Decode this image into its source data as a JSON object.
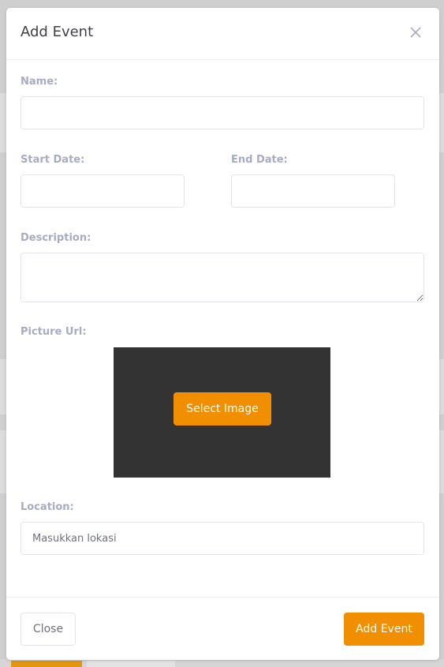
{
  "modal": {
    "title": "Add Event",
    "close_icon": "close-x-icon"
  },
  "form": {
    "name_label": "Name:",
    "name_value": "",
    "start_date_label": "Start Date:",
    "start_date_value": "",
    "end_date_label": "End Date:",
    "end_date_value": "",
    "description_label": "Description:",
    "description_value": "",
    "picture_url_label": "Picture Url:",
    "select_image_label": "Select Image",
    "location_label": "Location:",
    "location_placeholder": "Masukkan lokasi"
  },
  "footer": {
    "close_label": "Close",
    "add_event_label": "Add Event"
  },
  "colors": {
    "accent": "#f18f01",
    "label": "#a7abc3",
    "picture_bg": "#333333"
  }
}
